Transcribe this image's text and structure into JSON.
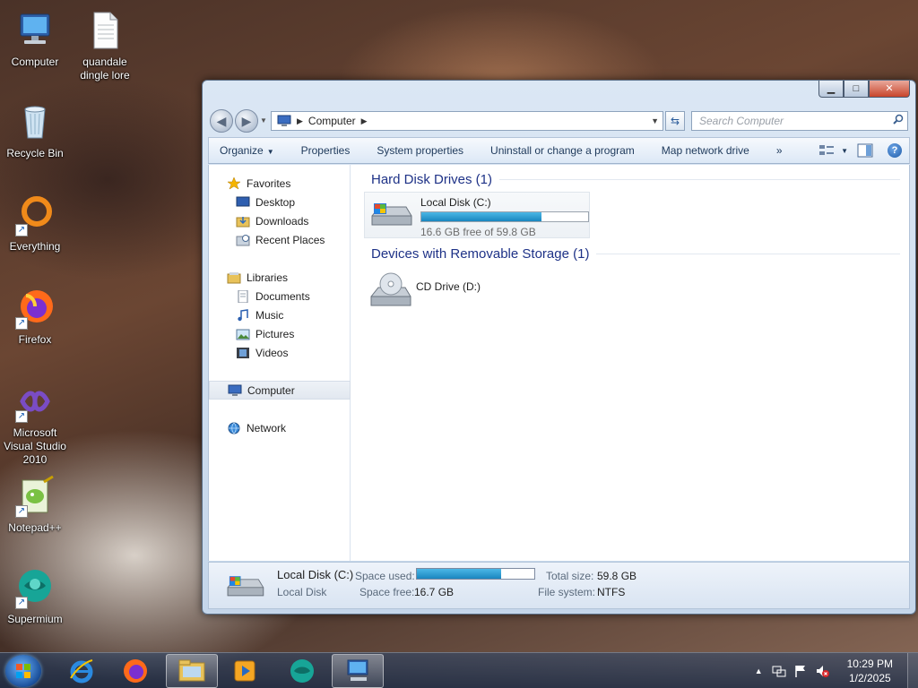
{
  "desktop": {
    "icons": [
      {
        "label": "Computer"
      },
      {
        "label": "quandale dingle lore"
      },
      {
        "label": "Recycle Bin"
      },
      {
        "label": "Everything"
      },
      {
        "label": "Firefox"
      },
      {
        "label": "Microsoft Visual Studio 2010"
      },
      {
        "label": "Notepad++"
      },
      {
        "label": "Supermium"
      }
    ]
  },
  "window": {
    "address": {
      "segment": "Computer"
    },
    "search": {
      "placeholder": "Search Computer"
    },
    "toolbar": {
      "organize": "Organize",
      "properties": "Properties",
      "system_properties": "System properties",
      "uninstall": "Uninstall or change a program",
      "map_drive": "Map network drive",
      "more": "»"
    },
    "nav": {
      "favorites": "Favorites",
      "desktop": "Desktop",
      "downloads": "Downloads",
      "recent": "Recent Places",
      "libraries": "Libraries",
      "documents": "Documents",
      "music": "Music",
      "pictures": "Pictures",
      "videos": "Videos",
      "computer": "Computer",
      "network": "Network"
    },
    "groups": {
      "hdd": "Hard Disk Drives (1)",
      "removable": "Devices with Removable Storage (1)"
    },
    "drives": {
      "c": {
        "name": "Local Disk (C:)",
        "free": "16.6 GB free of 59.8 GB",
        "used_fraction": 0.72
      },
      "d": {
        "name": "CD Drive (D:)"
      }
    },
    "details": {
      "name": "Local Disk (C:)",
      "type": "Local Disk",
      "space_used_label": "Space used:",
      "space_free_label": "Space free:",
      "space_free": "16.7 GB",
      "total_label": "Total size:",
      "total": "59.8 GB",
      "fs_label": "File system:",
      "fs": "NTFS",
      "used_fraction": 0.72
    }
  },
  "taskbar": {
    "apps": [
      "internet-explorer",
      "firefox",
      "windows-explorer",
      "media-player",
      "supermium",
      "computer"
    ],
    "clock": {
      "time": "10:29 PM",
      "date": "1/2/2025"
    }
  },
  "colors": {
    "accent": "#1e3287",
    "bar_fill": "#1a86bf"
  }
}
